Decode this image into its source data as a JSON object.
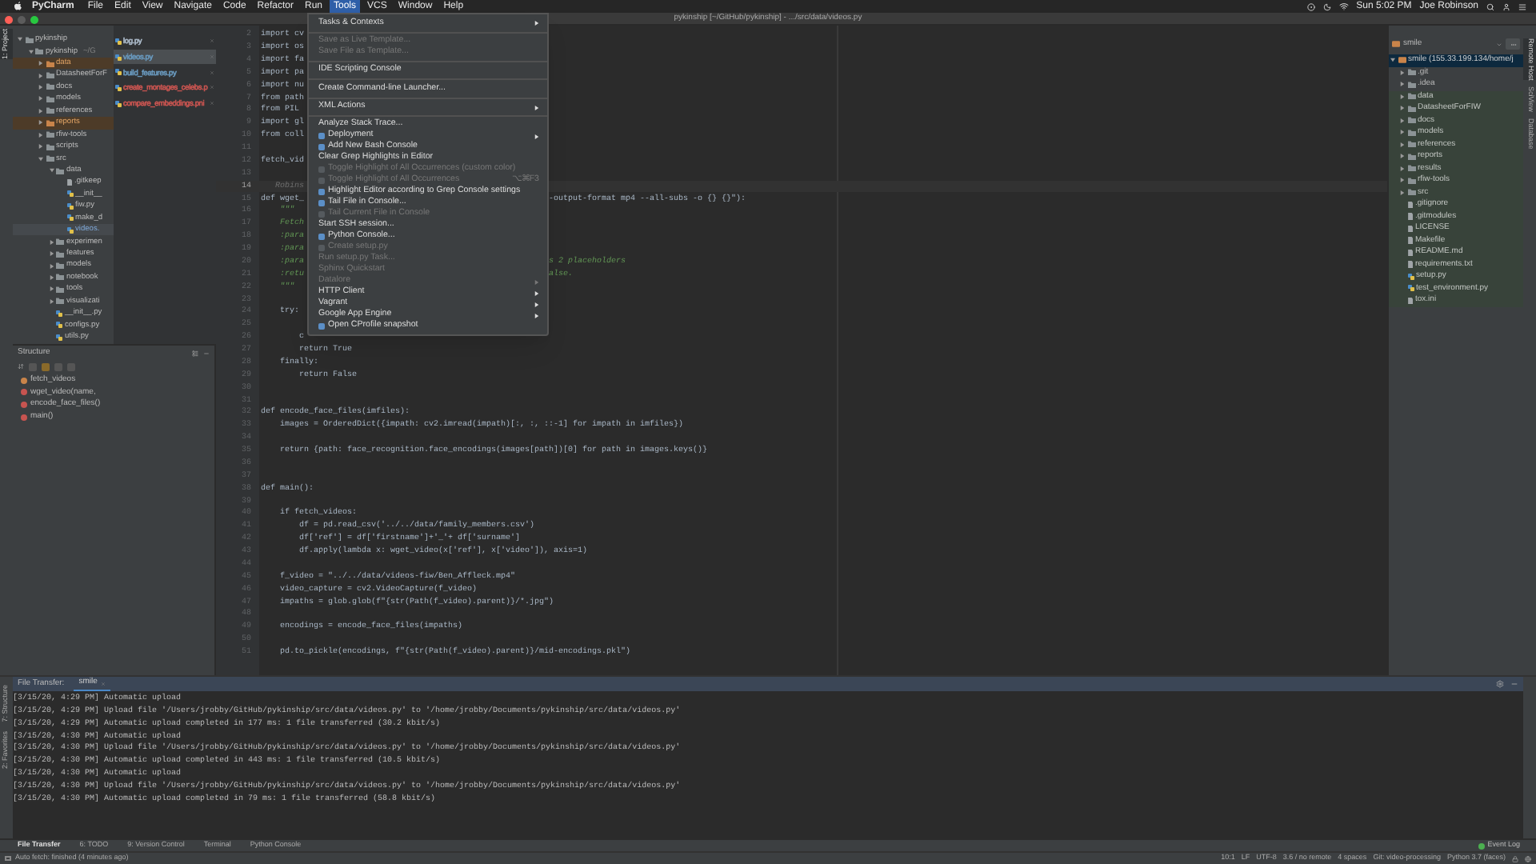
{
  "menubar": {
    "app_name": "PyCharm",
    "menus": [
      {
        "label": "File",
        "selected": false
      },
      {
        "label": "Edit",
        "selected": false
      },
      {
        "label": "View",
        "selected": false
      },
      {
        "label": "Navigate",
        "selected": false
      },
      {
        "label": "Code",
        "selected": false
      },
      {
        "label": "Refactor",
        "selected": false
      },
      {
        "label": "Run",
        "selected": false
      },
      {
        "label": "Tools",
        "selected": true
      },
      {
        "label": "VCS",
        "selected": false
      },
      {
        "label": "Window",
        "selected": false
      },
      {
        "label": "Help",
        "selected": false
      }
    ],
    "clock": "Sun 5:02 PM",
    "user": "Joe Robinson"
  },
  "window": {
    "title": "pykinship [~/GitHub/pykinship] - .../src/data/videos.py"
  },
  "left_strip": {
    "tabs": [
      {
        "label": "1: Project",
        "selected": true
      }
    ]
  },
  "project_tree": [
    {
      "label": "pykinship",
      "kind": "folder",
      "expanded": true,
      "selected": false,
      "excluded": false,
      "children": [
        {
          "label": "pykinship",
          "hint": "~/G",
          "kind": "folder",
          "expanded": true,
          "selected": false,
          "excluded": false,
          "children": [
            {
              "label": "data",
              "kind": "folder",
              "expanded": false,
              "selected": false,
              "excluded": true
            },
            {
              "label": "DatasheetForF",
              "kind": "folder",
              "expanded": false,
              "selected": false,
              "excluded": false
            },
            {
              "label": "docs",
              "kind": "folder",
              "expanded": false,
              "selected": false,
              "excluded": false
            },
            {
              "label": "models",
              "kind": "folder",
              "expanded": false,
              "selected": false,
              "excluded": false
            },
            {
              "label": "references",
              "kind": "folder",
              "expanded": false,
              "selected": false,
              "excluded": false
            },
            {
              "label": "reports",
              "kind": "folder",
              "expanded": false,
              "selected": false,
              "excluded": true
            },
            {
              "label": "rfiw-tools",
              "kind": "folder",
              "expanded": false,
              "selected": false,
              "excluded": false
            },
            {
              "label": "scripts",
              "kind": "folder",
              "expanded": false,
              "selected": false,
              "excluded": false
            },
            {
              "label": "src",
              "kind": "folder",
              "expanded": true,
              "selected": false,
              "excluded": false,
              "children": [
                {
                  "label": "data",
                  "kind": "folder",
                  "expanded": true,
                  "selected": false,
                  "excluded": false,
                  "children": [
                    {
                      "label": ".gitkeep",
                      "kind": "file",
                      "selected": false,
                      "excluded": false
                    },
                    {
                      "label": "__init__",
                      "kind": "pyfile",
                      "selected": false,
                      "excluded": false
                    },
                    {
                      "label": "fiw.py",
                      "kind": "pyfile",
                      "selected": false,
                      "excluded": false
                    },
                    {
                      "label": "make_d",
                      "kind": "pyfile",
                      "selected": false,
                      "excluded": false
                    },
                    {
                      "label": "videos.",
                      "kind": "pyfile",
                      "selected": true,
                      "excluded": false
                    }
                  ]
                },
                {
                  "label": "experimen",
                  "kind": "folder",
                  "expanded": false,
                  "selected": false,
                  "excluded": false
                },
                {
                  "label": "features",
                  "kind": "folder",
                  "expanded": false,
                  "selected": false,
                  "excluded": false
                },
                {
                  "label": "models",
                  "kind": "folder",
                  "expanded": false,
                  "selected": false,
                  "excluded": false
                },
                {
                  "label": "notebook",
                  "kind": "folder",
                  "expanded": false,
                  "selected": false,
                  "excluded": false
                },
                {
                  "label": "tools",
                  "kind": "folder",
                  "expanded": false,
                  "selected": false,
                  "excluded": false
                },
                {
                  "label": "visualizati",
                  "kind": "folder",
                  "expanded": false,
                  "selected": false,
                  "excluded": false
                },
                {
                  "label": "__init__.py",
                  "kind": "pyfile",
                  "selected": false,
                  "excluded": false
                },
                {
                  "label": "configs.py",
                  "kind": "pyfile",
                  "selected": false,
                  "excluded": false
                },
                {
                  "label": "utils.py",
                  "kind": "pyfile",
                  "selected": false,
                  "excluded": false
                }
              ]
            }
          ]
        }
      ]
    }
  ],
  "open_files": [
    {
      "label": "log.py",
      "color": "#a9b7c6",
      "selected": false
    },
    {
      "label": "videos.py",
      "color": "#6897bb",
      "selected": true
    },
    {
      "label": "build_features.py",
      "color": "#6897bb",
      "selected": false
    },
    {
      "label": "create_montages_celebs.p",
      "color": "#c75450",
      "selected": false
    },
    {
      "label": "compare_embeddings.pni",
      "color": "#c75450",
      "selected": false
    }
  ],
  "structure": {
    "title": "Structure",
    "items": [
      {
        "label": "fetch_videos",
        "kind": "variable"
      },
      {
        "label": "wget_video(name,",
        "kind": "function"
      },
      {
        "label": "encode_face_files()",
        "kind": "function"
      },
      {
        "label": "main()",
        "kind": "function"
      }
    ]
  },
  "editor": {
    "lines": [
      {
        "num": "2",
        "text": "import cv",
        "kind": "code",
        "current": false
      },
      {
        "num": "3",
        "text": "import os",
        "kind": "code",
        "current": false
      },
      {
        "num": "4",
        "text": "import fa",
        "kind": "code",
        "current": false
      },
      {
        "num": "5",
        "text": "import pa",
        "kind": "code",
        "current": false
      },
      {
        "num": "6",
        "text": "import nu",
        "kind": "code",
        "current": false
      },
      {
        "num": "7",
        "text": "from path",
        "kind": "code",
        "current": false
      },
      {
        "num": "8",
        "text": "from PIL",
        "kind": "code",
        "current": false
      },
      {
        "num": "9",
        "text": "import gl",
        "kind": "code",
        "current": false
      },
      {
        "num": "10",
        "text": "from coll",
        "kind": "code",
        "current": false
      },
      {
        "num": "11",
        "current": false
      },
      {
        "num": "12",
        "text": "fetch_vid",
        "kind": "code",
        "current": false
      },
      {
        "num": "13",
        "current": false
      },
      {
        "num": "14",
        "text": "   Robins",
        "kind": "hint",
        "current": true
      },
      {
        "num": "15",
        "text": "def wget_",
        "rest": "-output-format mp4 --all-subs -o {} {}\"):",
        "kind": "code",
        "current": false
      },
      {
        "num": "16",
        "text": "    \"\"\"",
        "kind": "doc",
        "current": false
      },
      {
        "num": "17",
        "text": "    Fetch",
        "kind": "doc",
        "current": false
      },
      {
        "num": "18",
        "text": "    :para",
        "kind": "doc",
        "current": false
      },
      {
        "num": "19",
        "text": "    :para",
        "kind": "doc",
        "current": false
      },
      {
        "num": "20",
        "text": "    :para",
        "rest": "s 2 placeholders",
        "kind": "doc",
        "current": false
      },
      {
        "num": "21",
        "text": "    :retu",
        "rest": "alse.",
        "kind": "doc",
        "current": false
      },
      {
        "num": "22",
        "text": "    \"\"\"",
        "kind": "doc",
        "current": false
      },
      {
        "num": "23",
        "current": false
      },
      {
        "num": "24",
        "text": "    try:",
        "kind": "code",
        "current": false
      },
      {
        "num": "25",
        "current": false
      },
      {
        "num": "26",
        "text": "        c",
        "kind": "code",
        "current": false
      },
      {
        "num": "27",
        "text": "        return True",
        "kind": "code",
        "current": false
      },
      {
        "num": "28",
        "text": "    finally:",
        "kind": "code",
        "current": false
      },
      {
        "num": "29",
        "text": "        return False",
        "kind": "code",
        "current": false
      },
      {
        "num": "30",
        "current": false
      },
      {
        "num": "31",
        "current": false
      },
      {
        "num": "32",
        "text": "def encode_face_files(imfiles):",
        "kind": "code",
        "current": false
      },
      {
        "num": "33",
        "text": "    images = OrderedDict({impath: cv2.imread(impath)[:, :, ::-1] for impath in imfiles})",
        "kind": "code",
        "current": false
      },
      {
        "num": "34",
        "current": false
      },
      {
        "num": "35",
        "text": "    return {path: face_recognition.face_encodings(images[path])[0] for path in images.keys()}",
        "kind": "code",
        "current": false
      },
      {
        "num": "36",
        "current": false
      },
      {
        "num": "37",
        "current": false
      },
      {
        "num": "38",
        "text": "def main():",
        "kind": "code",
        "current": false
      },
      {
        "num": "39",
        "current": false
      },
      {
        "num": "40",
        "text": "    if fetch_videos:",
        "kind": "code",
        "current": false
      },
      {
        "num": "41",
        "text": "        df = pd.read_csv('../../data/family_members.csv')",
        "kind": "code",
        "current": false
      },
      {
        "num": "42",
        "text": "        df['ref'] = df['firstname']+'_'+ df['surname']",
        "kind": "code",
        "current": false
      },
      {
        "num": "43",
        "text": "        df.apply(lambda x: wget_video(x['ref'], x['video']), axis=1)",
        "kind": "code",
        "current": false
      },
      {
        "num": "44",
        "current": false
      },
      {
        "num": "45",
        "text": "    f_video = \"../../data/videos-fiw/Ben_Affleck.mp4\"",
        "kind": "code",
        "current": false
      },
      {
        "num": "46",
        "text": "    video_capture = cv2.VideoCapture(f_video)",
        "kind": "code",
        "current": false
      },
      {
        "num": "47",
        "text": "    impaths = glob.glob(f\"{str(Path(f_video).parent)}/*.jpg\")",
        "kind": "code",
        "current": false
      },
      {
        "num": "48",
        "current": false
      },
      {
        "num": "49",
        "text": "    encodings = encode_face_files(impaths)",
        "kind": "code",
        "current": false
      },
      {
        "num": "50",
        "current": false
      },
      {
        "num": "51",
        "text": "    pd.to_pickle(encodings, f\"{str(Path(f_video).parent)}/mid-encodings.pkl\")",
        "kind": "code",
        "current": false
      }
    ]
  },
  "tools_menu": {
    "groups": [
      [
        {
          "label": "Tasks & Contexts",
          "kind": "plain",
          "disabled": false,
          "submenu": true
        }
      ],
      [
        {
          "label": "Save as Live Template...",
          "kind": "plain",
          "disabled": true,
          "submenu": false
        },
        {
          "label": "Save File as Template...",
          "kind": "plain",
          "disabled": true,
          "submenu": false
        }
      ],
      [
        {
          "label": "IDE Scripting Console",
          "kind": "plain",
          "disabled": false,
          "submenu": false
        }
      ],
      [
        {
          "label": "Create Command-line Launcher...",
          "kind": "plain",
          "disabled": false,
          "submenu": false
        }
      ],
      [
        {
          "label": "XML Actions",
          "kind": "plain",
          "disabled": false,
          "submenu": true
        }
      ],
      [
        {
          "label": "Analyze Stack Trace...",
          "kind": "plain",
          "disabled": false,
          "submenu": false
        },
        {
          "label": "Deployment",
          "kind": "icon",
          "disabled": false,
          "submenu": true
        },
        {
          "label": "Add New Bash Console",
          "kind": "icon",
          "disabled": false,
          "submenu": false
        },
        {
          "label": "Clear Grep Highlights in Editor",
          "kind": "plain",
          "disabled": false,
          "submenu": false
        },
        {
          "label": "Toggle Highlight of All Occurrences (custom color)",
          "kind": "icon",
          "disabled": true,
          "submenu": false
        },
        {
          "label": "Toggle Highlight of All Occurrences",
          "kind": "icon",
          "disabled": true,
          "submenu": false,
          "shortcut": "⌥⌘F3"
        },
        {
          "label": "Highlight Editor according to Grep Console settings",
          "kind": "icon",
          "disabled": false,
          "submenu": false
        },
        {
          "label": "Tail File in Console...",
          "kind": "icon",
          "disabled": false,
          "submenu": false
        },
        {
          "label": "Tail Current File in Console",
          "kind": "icon",
          "disabled": true,
          "submenu": false
        },
        {
          "label": "Start SSH session...",
          "kind": "plain",
          "disabled": false,
          "submenu": false
        },
        {
          "label": "Python Console...",
          "kind": "icon",
          "disabled": false,
          "submenu": false
        },
        {
          "label": "Create setup.py",
          "kind": "icon",
          "disabled": true,
          "submenu": false
        },
        {
          "label": "Run setup.py Task...",
          "kind": "plain",
          "disabled": true,
          "submenu": false
        },
        {
          "label": "Sphinx Quickstart",
          "kind": "plain",
          "disabled": true,
          "submenu": false
        },
        {
          "label": "Datalore",
          "kind": "plain",
          "disabled": true,
          "submenu": true
        },
        {
          "label": "HTTP Client",
          "kind": "plain",
          "disabled": false,
          "submenu": true
        },
        {
          "label": "Vagrant",
          "kind": "plain",
          "disabled": false,
          "submenu": true
        },
        {
          "label": "Google App Engine",
          "kind": "plain",
          "disabled": false,
          "submenu": true
        },
        {
          "label": "Open CProfile snapshot",
          "kind": "icon",
          "disabled": false,
          "submenu": false
        }
      ]
    ]
  },
  "remote_panel": {
    "host": "smile",
    "tree": [
      {
        "label": "smile (155.33.199.134/home/j",
        "kind": "host",
        "expanded": true,
        "selected": true,
        "highlighted": false,
        "children": [
          {
            "label": ".git",
            "kind": "folder",
            "expanded": false,
            "selected": false,
            "highlighted": false
          },
          {
            "label": ".idea",
            "kind": "folder",
            "expanded": false,
            "selected": false,
            "highlighted": false
          },
          {
            "label": "data",
            "kind": "folder",
            "expanded": false,
            "selected": false,
            "highlighted": true
          },
          {
            "label": "DatasheetForFIW",
            "kind": "folder",
            "expanded": false,
            "selected": false,
            "highlighted": true
          },
          {
            "label": "docs",
            "kind": "folder",
            "expanded": false,
            "selected": false,
            "highlighted": true
          },
          {
            "label": "models",
            "kind": "folder",
            "expanded": false,
            "selected": false,
            "highlighted": true
          },
          {
            "label": "references",
            "kind": "folder",
            "expanded": false,
            "selected": false,
            "highlighted": true
          },
          {
            "label": "reports",
            "kind": "folder",
            "expanded": false,
            "selected": false,
            "highlighted": true
          },
          {
            "label": "results",
            "kind": "folder",
            "expanded": false,
            "selected": false,
            "highlighted": true
          },
          {
            "label": "rfiw-tools",
            "kind": "folder",
            "expanded": false,
            "selected": false,
            "highlighted": true
          },
          {
            "label": "src",
            "kind": "folder",
            "expanded": false,
            "selected": false,
            "highlighted": true
          },
          {
            "label": ".gitignore",
            "kind": "file",
            "selected": false,
            "highlighted": true
          },
          {
            "label": ".gitmodules",
            "kind": "file",
            "selected": false,
            "highlighted": true
          },
          {
            "label": "LICENSE",
            "kind": "file",
            "selected": false,
            "highlighted": true
          },
          {
            "label": "Makefile",
            "kind": "file",
            "selected": false,
            "highlighted": true
          },
          {
            "label": "README.md",
            "kind": "file",
            "selected": false,
            "highlighted": true
          },
          {
            "label": "requirements.txt",
            "kind": "file",
            "selected": false,
            "highlighted": true
          },
          {
            "label": "setup.py",
            "kind": "pyfile",
            "selected": false,
            "highlighted": true
          },
          {
            "label": "test_environment.py",
            "kind": "pyfile",
            "selected": false,
            "highlighted": true
          },
          {
            "label": "tox.ini",
            "kind": "file",
            "selected": false,
            "highlighted": true
          }
        ]
      }
    ]
  },
  "right_strip": {
    "tabs": [
      {
        "label": "Remote Host",
        "selected": true
      },
      {
        "label": "SciView",
        "selected": false
      },
      {
        "label": "Database",
        "selected": false
      }
    ]
  },
  "file_transfer": {
    "title": "File Transfer:",
    "tabs": [
      {
        "label": "smile",
        "selected": true
      }
    ],
    "log": [
      "[3/15/20, 4:29 PM] Automatic upload",
      "[3/15/20, 4:29 PM] Upload file '/Users/jrobby/GitHub/pykinship/src/data/videos.py' to '/home/jrobby/Documents/pykinship/src/data/videos.py'",
      "[3/15/20, 4:29 PM] Automatic upload completed in 177 ms: 1 file transferred (30.2 kbit/s)",
      "[3/15/20, 4:30 PM] Automatic upload",
      "[3/15/20, 4:30 PM] Upload file '/Users/jrobby/GitHub/pykinship/src/data/videos.py' to '/home/jrobby/Documents/pykinship/src/data/videos.py'",
      "[3/15/20, 4:30 PM] Automatic upload completed in 443 ms: 1 file transferred (10.5 kbit/s)",
      "[3/15/20, 4:30 PM] Automatic upload",
      "[3/15/20, 4:30 PM] Upload file '/Users/jrobby/GitHub/pykinship/src/data/videos.py' to '/home/jrobby/Documents/pykinship/src/data/videos.py'",
      "[3/15/20, 4:30 PM] Automatic upload completed in 79 ms: 1 file transferred (58.8 kbit/s)"
    ]
  },
  "bottom_strip": {
    "tabs": [
      {
        "label": "7: Structure",
        "selected": false
      },
      {
        "label": "2: Favorites",
        "selected": false
      }
    ]
  },
  "tool_windows": [
    {
      "label": "File Transfer",
      "selected": true
    },
    {
      "label": "6: TODO",
      "selected": false
    },
    {
      "label": "9: Version Control",
      "selected": false
    },
    {
      "label": "Terminal",
      "selected": false
    },
    {
      "label": "Python Console",
      "selected": false
    }
  ],
  "event_log": {
    "label": "Event Log"
  },
  "status_bar": {
    "message": "Auto fetch: finished (4 minutes ago)",
    "items": [
      "10:1",
      "LF",
      "UTF-8",
      "3.6 / no remote",
      "4 spaces",
      "Git: video-processing",
      "Python 3.7 (faces)"
    ]
  }
}
